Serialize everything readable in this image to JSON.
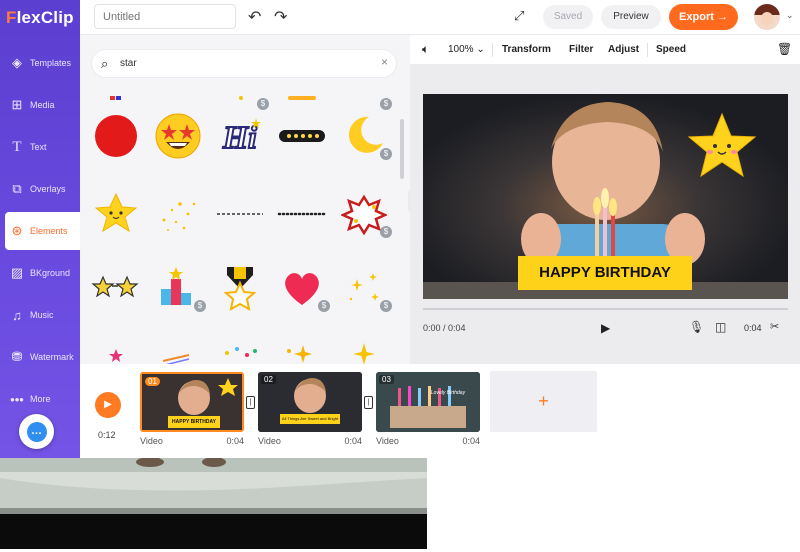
{
  "app": {
    "logo_prefix": "F",
    "logo_rest": "lexClip"
  },
  "sidebar": {
    "items": [
      {
        "label": "Templates",
        "icon": "layers-icon"
      },
      {
        "label": "Media",
        "icon": "media-icon"
      },
      {
        "label": "Text",
        "icon": "text-icon"
      },
      {
        "label": "Overlays",
        "icon": "overlays-icon"
      },
      {
        "label": "Elements",
        "icon": "elements-icon",
        "active": true
      },
      {
        "label": "BKground",
        "icon": "background-icon"
      },
      {
        "label": "Music",
        "icon": "music-icon"
      },
      {
        "label": "Watermark",
        "icon": "watermark-icon"
      },
      {
        "label": "More",
        "icon": "more-icon"
      }
    ]
  },
  "header": {
    "title_placeholder": "Untitled",
    "saved_label": "Saved",
    "preview_label": "Preview",
    "export_label": "Export →",
    "accent_color": "#ff6a1f"
  },
  "elements_panel": {
    "search_value": "star"
  },
  "editor": {
    "toolbar": {
      "zoom": "100%",
      "transform_label": "Transform",
      "filter_label": "Filter",
      "adjust_label": "Adjust",
      "speed_label": "Speed"
    },
    "overlay_text": "HAPPY BIRTHDAY",
    "time_current": "0:00 / 0:04",
    "time_total": "0:04"
  },
  "timeline": {
    "total_time": "0:12",
    "clips": [
      {
        "number": "01",
        "type": "Video",
        "duration": "0:04",
        "caption": "HAPPY BIRTHDAY"
      },
      {
        "number": "02",
        "type": "Video",
        "duration": "0:04",
        "caption": "All Things Are Sweet and Bright"
      },
      {
        "number": "03",
        "type": "Video",
        "duration": "0:04",
        "caption": "Lovely Birthday"
      }
    ],
    "add_label": "+"
  }
}
